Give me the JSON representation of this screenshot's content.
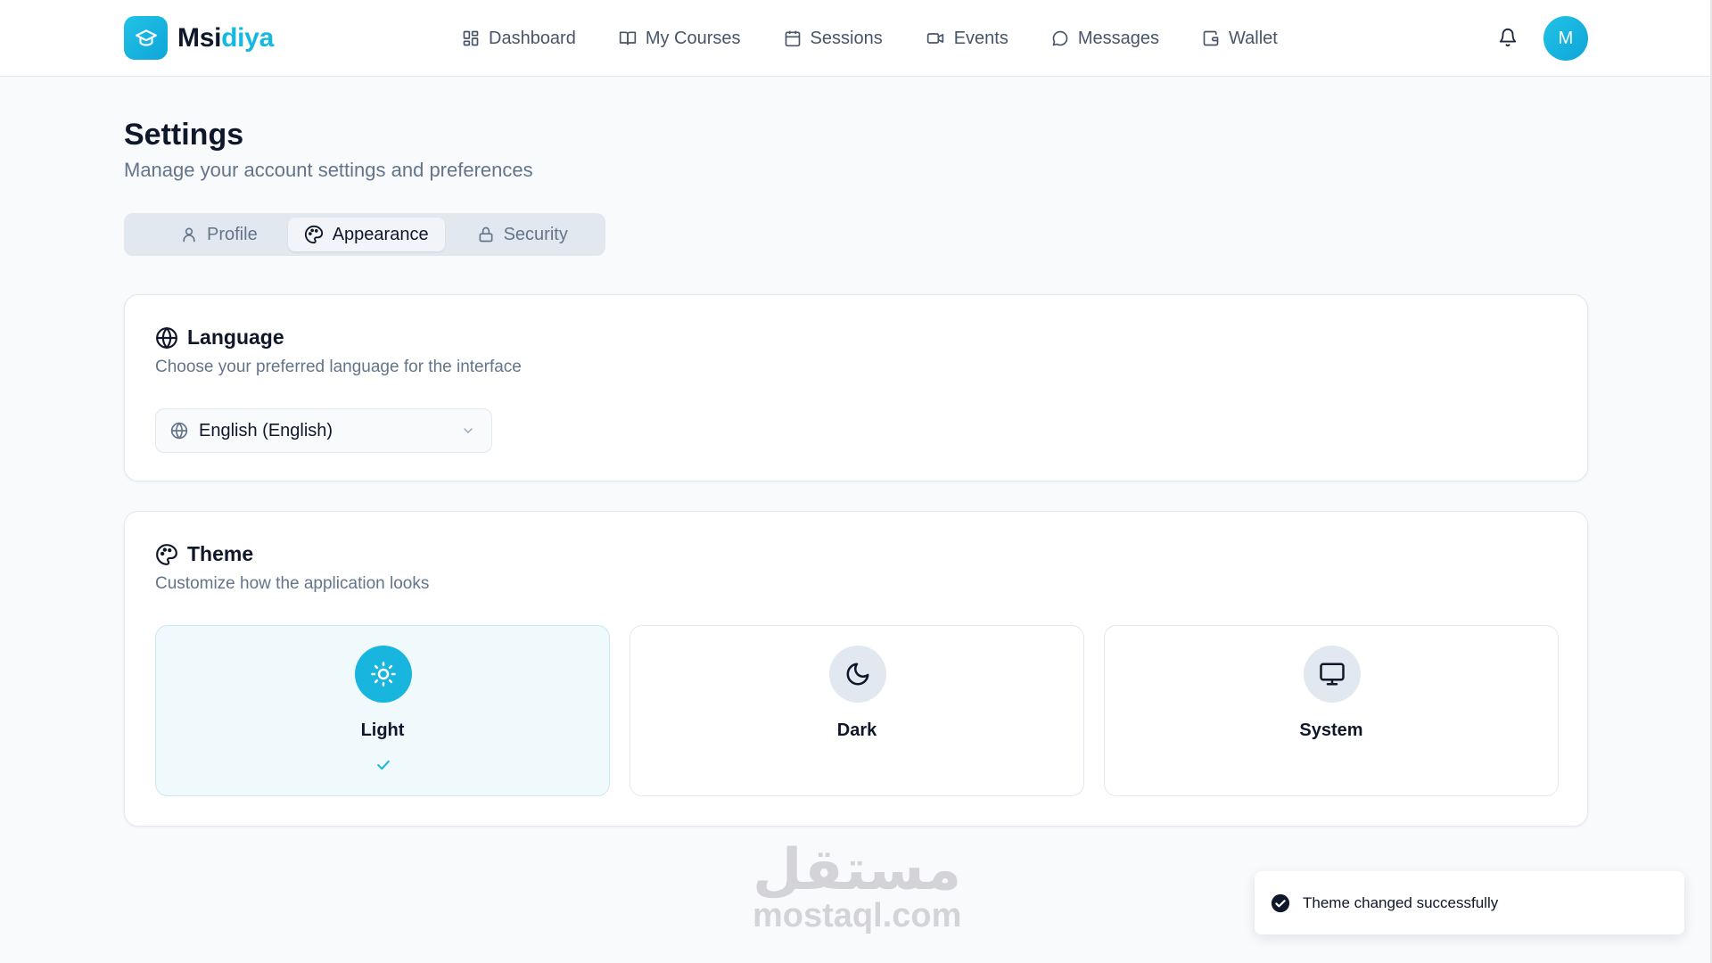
{
  "app": {
    "name_part1": "Msi",
    "name_part2": "diya"
  },
  "nav": [
    {
      "label": "Dashboard",
      "icon": "dashboard-icon"
    },
    {
      "label": "My Courses",
      "icon": "book-icon"
    },
    {
      "label": "Sessions",
      "icon": "calendar-icon"
    },
    {
      "label": "Events",
      "icon": "video-icon"
    },
    {
      "label": "Messages",
      "icon": "message-icon"
    },
    {
      "label": "Wallet",
      "icon": "wallet-icon"
    }
  ],
  "user": {
    "avatar_initial": "M"
  },
  "page": {
    "title": "Settings",
    "subtitle": "Manage your account settings and preferences"
  },
  "tabs": [
    {
      "label": "Profile",
      "icon": "user-icon",
      "active": false
    },
    {
      "label": "Appearance",
      "icon": "palette-icon",
      "active": true
    },
    {
      "label": "Security",
      "icon": "lock-icon",
      "active": false
    }
  ],
  "language": {
    "title": "Language",
    "description": "Choose your preferred language for the interface",
    "selected": "English (English)"
  },
  "theme": {
    "title": "Theme",
    "description": "Customize how the application looks",
    "options": [
      {
        "label": "Light",
        "icon": "sun-icon",
        "selected": true
      },
      {
        "label": "Dark",
        "icon": "moon-icon",
        "selected": false
      },
      {
        "label": "System",
        "icon": "monitor-icon",
        "selected": false
      }
    ]
  },
  "watermark": {
    "arabic": "مستقل",
    "latin": "mostaql.com"
  },
  "toast": {
    "message": "Theme changed successfully"
  },
  "colors": {
    "accent": "#18b6df",
    "text": "#0f172a",
    "muted": "#64748b",
    "border": "#e2e8f0"
  }
}
